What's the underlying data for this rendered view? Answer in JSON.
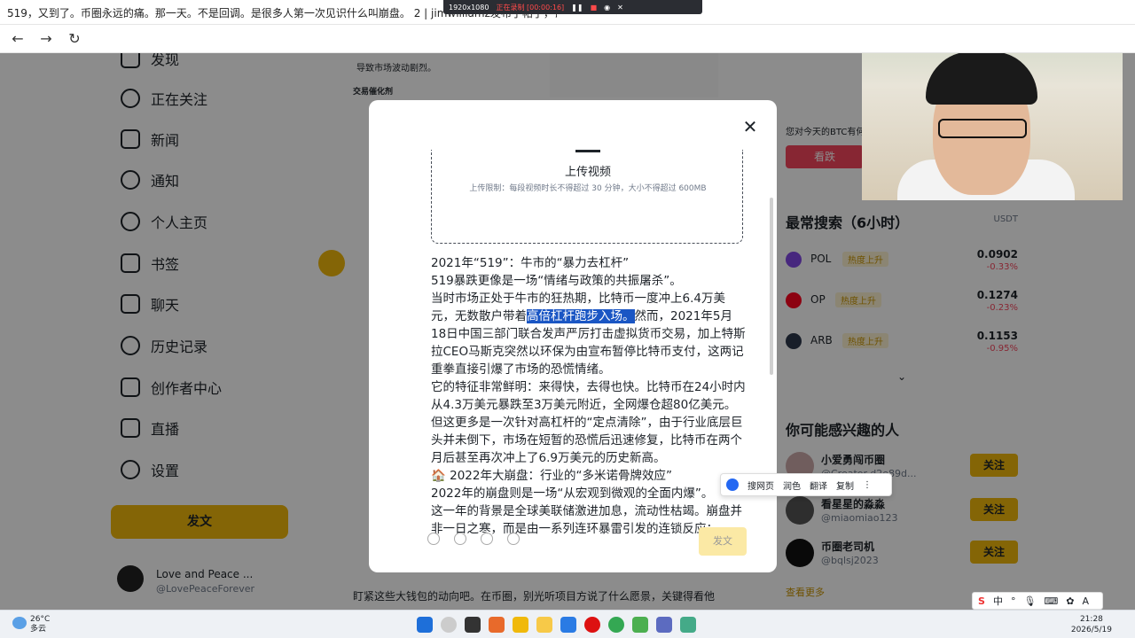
{
  "browser": {
    "tab_title": "519，又到了。币圈永远的痛。那一天。不是回调。是很多人第一次见识什么叫崩盘。 2 | jimwilliamz发布了帖子，请..."
  },
  "recorder": {
    "resolution": "1920x1080",
    "status": "正在录制 [00:00:16]"
  },
  "sidebar": {
    "items": [
      {
        "label": "发现"
      },
      {
        "label": "正在关注"
      },
      {
        "label": "新闻"
      },
      {
        "label": "通知"
      },
      {
        "label": "个人主页"
      },
      {
        "label": "书签"
      },
      {
        "label": "聊天"
      },
      {
        "label": "历史记录"
      },
      {
        "label": "创作者中心"
      },
      {
        "label": "直播"
      },
      {
        "label": "设置"
      }
    ],
    "post_button": "发文",
    "profile": {
      "name": "Love and Peace ...",
      "handle": "@LovePeaceForever"
    }
  },
  "feed": {
    "line1": "导致市场波动剧烈。",
    "line2": "交易催化剂",
    "bottom_line": "盯紧这些大钱包的动向吧。在币圈，别光听项目方说了什么愿景，关键得看他"
  },
  "right_panel": {
    "sentiment_text": "您对今天的BTC有何...",
    "bear_button": "看跌",
    "hot_title": "最常搜索（6小时）",
    "hot_unit": "USDT",
    "hot_tag": "热度上升",
    "coins": [
      {
        "name": "POL",
        "price": "0.0902",
        "change": "-0.33%",
        "color": "#8247e5"
      },
      {
        "name": "OP",
        "price": "0.1274",
        "change": "-0.23%",
        "color": "#ff0420"
      },
      {
        "name": "ARB",
        "price": "0.1153",
        "change": "-0.95%",
        "color": "#2d374b"
      }
    ],
    "people_title": "你可能感兴趣的人",
    "follow_label": "关注",
    "people": [
      {
        "name": "小爱勇闯币圈",
        "handle": "@Creator-d2e89d..."
      },
      {
        "name": "看星星的淼淼",
        "handle": "@miaomiao123"
      },
      {
        "name": "币圈老司机",
        "handle": "@bqlsj2023"
      }
    ],
    "see_more": "查看更多"
  },
  "modal": {
    "upload_title": "上传视频",
    "upload_limit": "上传限制：每段视频时长不得超过 30 分钟，大小不得超过 600MB",
    "p1": "2021年“519”：牛市的“暴力去杠杆”",
    "p2": "519暴跌更像是一场“情绪与政策的共振屠杀”。",
    "p3_a": "当时市场正处于牛市的狂热期，比特币一度冲上6.4万美元，无数散户带着",
    "p3_hl": "高倍杠杆跑步入场。",
    "p3_b": "然而，2021年5月18日中国三部门联合发声严厉打击虚拟货币交易，加上特斯拉CEO马斯克突然以环保为由宣布暂停比特币支付，这两记重拳直接引爆了市场的恐慌情绪。",
    "p4": "它的特征非常鲜明：来得快，去得也快。比特币在24小时内从4.3万美元暴跌至3万美元附近，全网爆仓超80亿美元。但这更多是一次针对高杠杆的“定点清除”，由于行业底层巨头并未倒下，市场在短暂的恐慌后迅速修复，比特币在两个月后甚至再次冲上了6.9万美元的历史新高。",
    "p5": "🏠 2022年大崩盘：行业的“多米诺骨牌效应”",
    "p6": "2022年的崩盘则是一场“从宏观到微观的全面内爆”。",
    "p7": "这一年的背景是全球美联储激进加息，流动性枯竭。崩盘并非一日之寒，而是由一系列连环暴雷引发的连锁反应：",
    "post_label": "发文"
  },
  "selection_popup": {
    "items": [
      "搜网页",
      "润色",
      "翻译",
      "复制"
    ]
  },
  "ime": {
    "label": "中"
  },
  "taskbar": {
    "temp": "26°C",
    "weather": "多云",
    "time": "21:28",
    "date": "2026/5/19"
  }
}
